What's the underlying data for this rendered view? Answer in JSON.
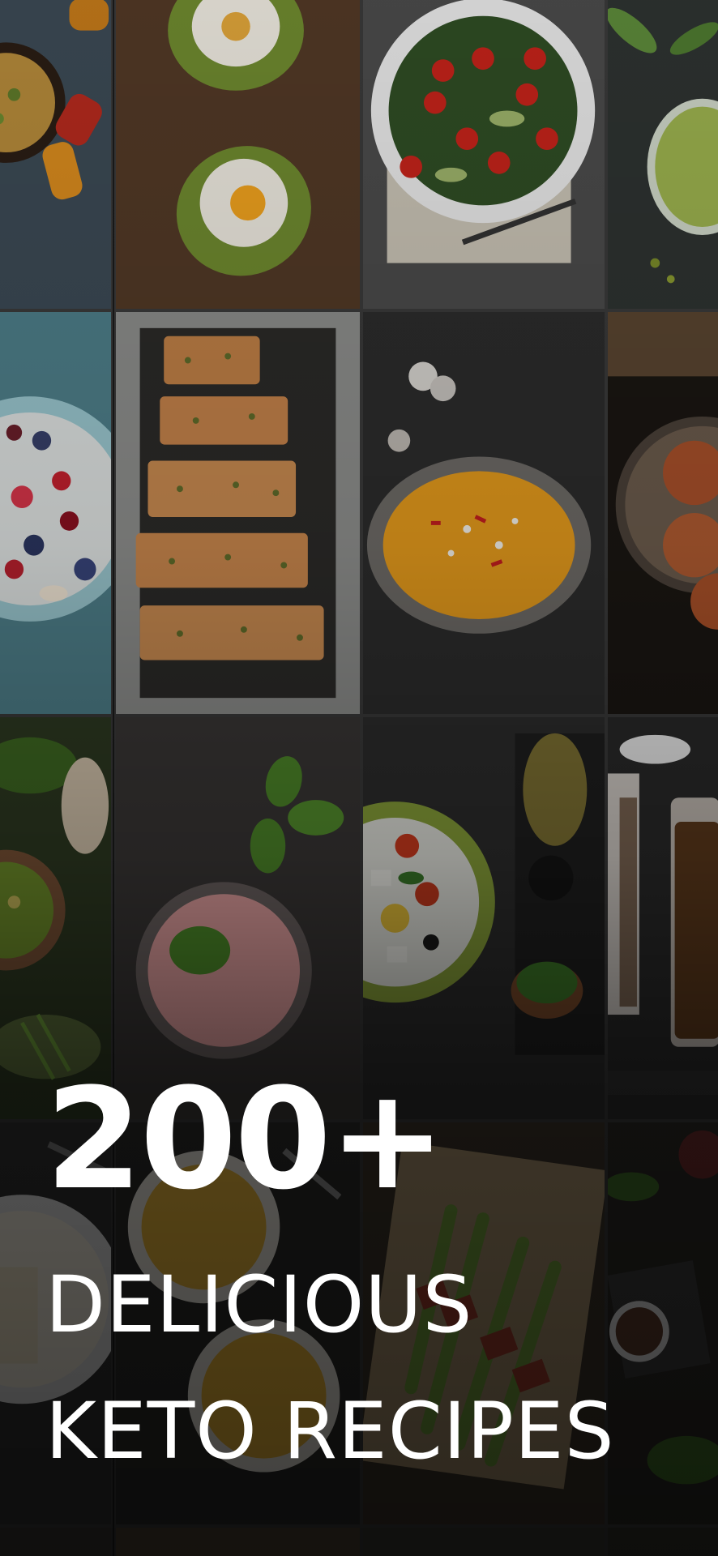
{
  "promo": {
    "headline": "200+",
    "subline_1": "DELICIOUS",
    "subline_2": "KETO RECIPES"
  },
  "photos": [
    "skillet-omelette",
    "avocado-baked-egg",
    "spinach-tomato-salad",
    "green-smoothie",
    "berry-chia-bowl",
    "baked-salmon-fillets",
    "pumpkin-soup",
    "keto-patties",
    "guacamole-bowl",
    "strawberry-smoothie",
    "greek-salad",
    "jar-preserves",
    "creamy-pasta",
    "lemon-curd-bowls",
    "asparagus-bacon-wraps",
    "herbs-and-peppercorns"
  ],
  "colors": {
    "text": "#ffffff",
    "tile_border": "#3a3a3a"
  }
}
